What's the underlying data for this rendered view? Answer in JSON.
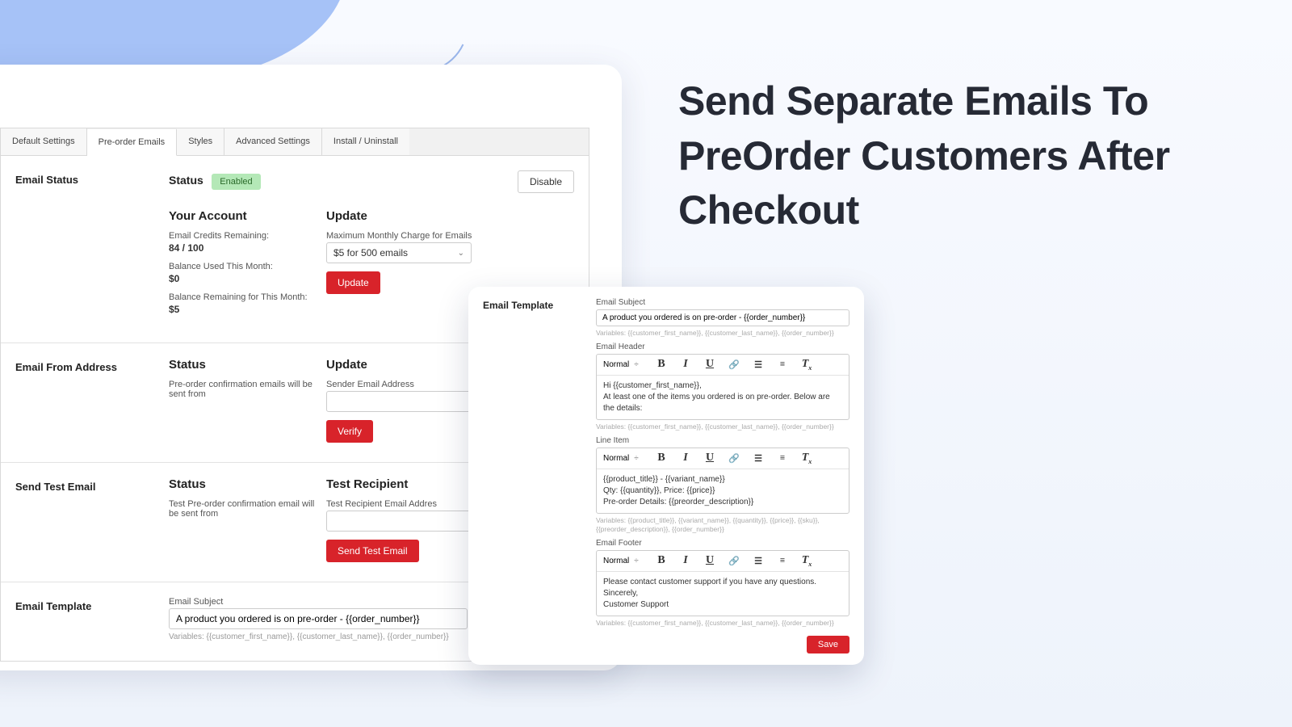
{
  "headline": "Send Separate Emails To PreOrder Customers After Checkout",
  "tabs": [
    {
      "label": "Default Settings"
    },
    {
      "label": "Pre-order Emails"
    },
    {
      "label": "Styles"
    },
    {
      "label": "Advanced Settings"
    },
    {
      "label": "Install / Uninstall"
    }
  ],
  "status_section": {
    "label": "Email Status",
    "status_label": "Status",
    "status_value": "Enabled",
    "disable_btn": "Disable",
    "account_heading": "Your Account",
    "credits_label": "Email Credits Remaining:",
    "credits_value": "84 / 100",
    "balance_used_label": "Balance Used This Month:",
    "balance_used_value": "$0",
    "balance_remaining_label": "Balance Remaining for This Month:",
    "balance_remaining_value": "$5",
    "update_heading": "Update",
    "max_charge_label": "Maximum Monthly Charge for Emails",
    "max_charge_value": "$5 for 500 emails",
    "update_btn": "Update"
  },
  "from_section": {
    "label": "Email From Address",
    "status_heading": "Status",
    "status_text": "Pre-order confirmation emails will be sent from",
    "update_heading": "Update",
    "sender_label": "Sender Email Address",
    "verify_btn": "Verify"
  },
  "test_section": {
    "label": "Send Test Email",
    "status_heading": "Status",
    "status_text": "Test Pre-order confirmation email will be sent from",
    "recipient_heading": "Test Recipient",
    "recipient_label": "Test Recipient Email Addres",
    "send_btn": "Send Test Email"
  },
  "template_back": {
    "label": "Email Template",
    "subject_label": "Email Subject",
    "subject_value": "A product you ordered is on pre-order - {{order_number}}",
    "vars": "Variables:  {{customer_first_name}}, {{customer_last_name}}, {{order_number}}"
  },
  "front": {
    "label": "Email Template",
    "subject_label": "Email Subject",
    "subject_value": "A product you ordered is on pre-order - {{order_number}}",
    "vars1": "Variables:  {{customer_first_name}}, {{customer_last_name}}, {{order_number}}",
    "header_label": "Email Header",
    "toolbar_style": "Normal",
    "header_line1": "Hi {{customer_first_name}},",
    "header_line2": "At least one of the items you ordered is on pre-order. Below are the details:",
    "vars2": "Variables:  {{customer_first_name}}, {{customer_last_name}}, {{order_number}}",
    "lineitem_label": "Line Item",
    "lineitem_line1": "{{product_title}} - {{variant_name}}",
    "lineitem_line2": "Qty: {{quantity}}, Price: {{price}}",
    "lineitem_line3": "Pre-order Details: {{preorder_description}}",
    "vars3": "Variables:  {{product_title}}, {{variant_name}}, {{quantity}}, {{price}}, {{sku}}, {{preorder_description}}, {{order_number}}",
    "footer_label": "Email Footer",
    "footer_line1": "Please contact customer support if you have any questions.",
    "footer_line2": "Sincerely,",
    "footer_line3": "Customer Support",
    "vars4": "Variables:  {{customer_first_name}}, {{customer_last_name}}, {{order_number}}",
    "save_btn": "Save"
  }
}
